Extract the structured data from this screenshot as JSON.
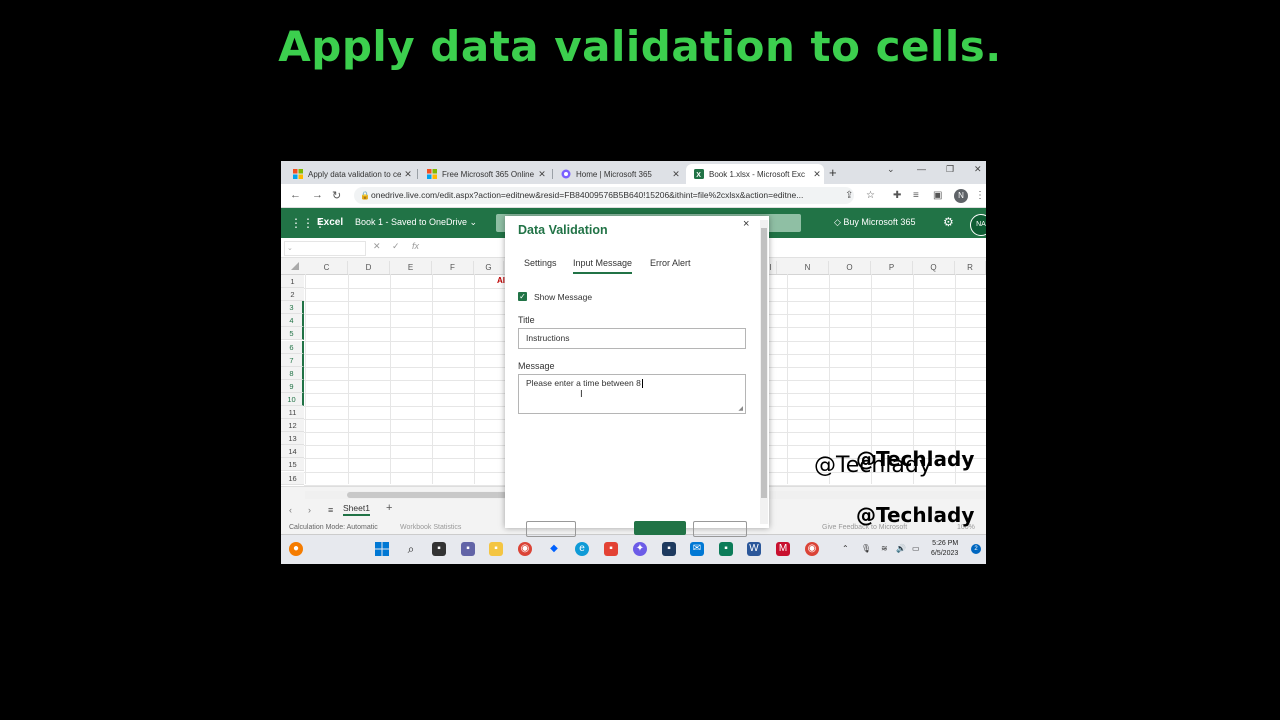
{
  "video_title": "Apply data validation to cells.",
  "browser": {
    "tabs": [
      {
        "label": "Apply data validation to ce",
        "active": false
      },
      {
        "label": "Free Microsoft 365 Online",
        "active": false
      },
      {
        "label": "Home | Microsoft 365",
        "active": false
      },
      {
        "label": "Book 1.xlsx - Microsoft Exc",
        "active": true
      }
    ],
    "tab_close": "✕",
    "new_tab": "+",
    "url": "onedrive.live.com/edit.aspx?action=editnew&resid=FB84009576B5B640!15206&ithint=file%2cxlsx&action=editne...",
    "profile_initial": "N"
  },
  "excel": {
    "app_name": "Excel",
    "doc_name": "Book 1 - Saved to OneDrive ⌄",
    "buy_label": "Buy Microsoft 365",
    "avatar_initials": "NA",
    "fx_label": "fx",
    "columns_left": [
      "C",
      "D",
      "E",
      "F",
      "G"
    ],
    "columns_right": [
      "I",
      "N",
      "O",
      "P",
      "Q",
      "R"
    ],
    "rows": [
      "1",
      "2",
      "3",
      "4",
      "5",
      "6",
      "7",
      "8",
      "9",
      "10",
      "11",
      "12",
      "13",
      "14",
      "15",
      "16"
    ],
    "cell_text": "Al",
    "sheet_tab": "Sheet1",
    "add_sheet": "+",
    "status_left": "Calculation Mode: Automatic",
    "status_mid": "Workbook Statistics",
    "status_right": "Give Feedback to Microsoft",
    "zoom": "100%"
  },
  "dialog": {
    "title": "Data Validation",
    "close": "×",
    "tabs": [
      {
        "label": "Settings",
        "active": false
      },
      {
        "label": "Input Message",
        "active": true
      },
      {
        "label": "Error Alert",
        "active": false
      }
    ],
    "show_message_label": "Show Message",
    "show_message_checked": true,
    "title_label": "Title",
    "title_value": "Instructions",
    "message_label": "Message",
    "message_value": "Please enter a time between 8"
  },
  "taskbar": {
    "time": "5:26 PM",
    "date": "6/5/2023",
    "notifications": "2"
  },
  "watermarks": {
    "main": "@Techlady",
    "secondary": "@Techlady",
    "typed": "@Techlady"
  },
  "colors": {
    "excel_green": "#217346",
    "title_green": "#3ccf4e"
  }
}
